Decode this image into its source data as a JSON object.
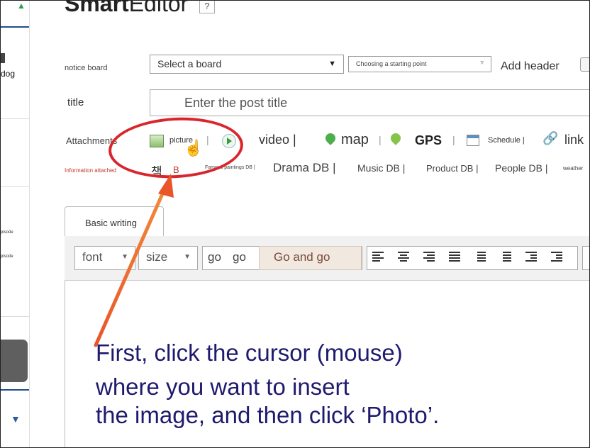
{
  "header": {
    "brand_bold": "Smart",
    "brand_thin": "Editor",
    "help": "?"
  },
  "sidebar": {
    "label_dog": "dog",
    "label_episode1": "pisode",
    "label_episode2": "pisode",
    "dropdown_arrow": "▼"
  },
  "notice_board": {
    "label": "notice board",
    "board_select": "Select a board",
    "board_arrow": "▼",
    "start_select": "Choosing a starting point",
    "start_arrow": "▿",
    "add_header": "Add header"
  },
  "title_row": {
    "label": "title",
    "placeholder": "Enter the post title"
  },
  "attachments": {
    "label": "Attachments",
    "picture": "picture",
    "sep1": "|",
    "video": "video |",
    "map": "map",
    "sep2": "|",
    "gps": "GPS",
    "sep3": "|",
    "schedule": "Schedule |",
    "link": "link"
  },
  "info_attached": {
    "label": "Information attached",
    "book_db_korean": "책",
    "book_db_b": "B",
    "famous_paintings": "Famous paintings DB |",
    "drama": "Drama DB |",
    "music": "Music DB |",
    "product": "Product DB |",
    "people": "People DB |",
    "weather": "weather"
  },
  "editor": {
    "tab": "Basic writing",
    "font": "font",
    "size": "size",
    "go1": "go",
    "go2": "go",
    "go_and_go": "Go and go",
    "dd_arrow": "▼"
  },
  "instruction": {
    "line1": "First, click the cursor (mouse)",
    "line2": "where you want to insert",
    "line3": "the image, and then click ‘Photo’."
  },
  "colors": {
    "annotation_red": "#d8262c",
    "instruction_text": "#1f1a6e",
    "arrow_orange": "#e8562a"
  }
}
